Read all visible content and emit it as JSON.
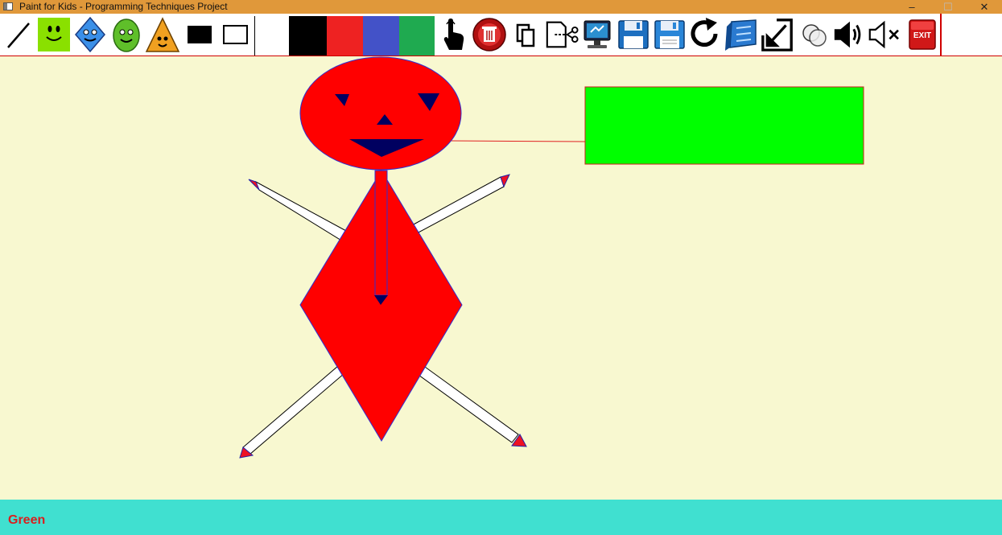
{
  "window": {
    "title": "Paint for Kids - Programming Techniques Project",
    "minimize_glyph": "–",
    "maximize_glyph": "☐",
    "close_glyph": "✕"
  },
  "toolbar": {
    "tools": [
      {
        "name": "line-icon"
      },
      {
        "name": "square-face-icon"
      },
      {
        "name": "diamond-face-icon"
      },
      {
        "name": "ellipse-face-icon"
      },
      {
        "name": "triangle-face-icon"
      },
      {
        "name": "filled-rectangle-icon"
      },
      {
        "name": "outline-rectangle-icon"
      }
    ],
    "palette": [
      {
        "name": "white",
        "color": "#ffffff"
      },
      {
        "name": "black",
        "color": "#000000"
      },
      {
        "name": "red",
        "color": "#ee2222"
      },
      {
        "name": "blue",
        "color": "#4352c8"
      },
      {
        "name": "green",
        "color": "#1faa50"
      }
    ],
    "actions": [
      {
        "name": "select-pointer-icon"
      },
      {
        "name": "delete-icon"
      },
      {
        "name": "copy-icon"
      },
      {
        "name": "cut-icon"
      },
      {
        "name": "paste-icon"
      },
      {
        "name": "save-icon"
      },
      {
        "name": "save-as-icon"
      },
      {
        "name": "redo-icon"
      },
      {
        "name": "load-icon"
      },
      {
        "name": "resize-icon"
      },
      {
        "name": "circles-icon"
      },
      {
        "name": "sound-on-icon"
      },
      {
        "name": "sound-off-icon"
      },
      {
        "name": "exit-icon"
      }
    ],
    "exit_label": "EXIT"
  },
  "canvas": {
    "background": "#f8f8d0",
    "fill_color": "#ff0000",
    "outline_color": "#3030d0"
  },
  "status": {
    "text": "Green"
  }
}
